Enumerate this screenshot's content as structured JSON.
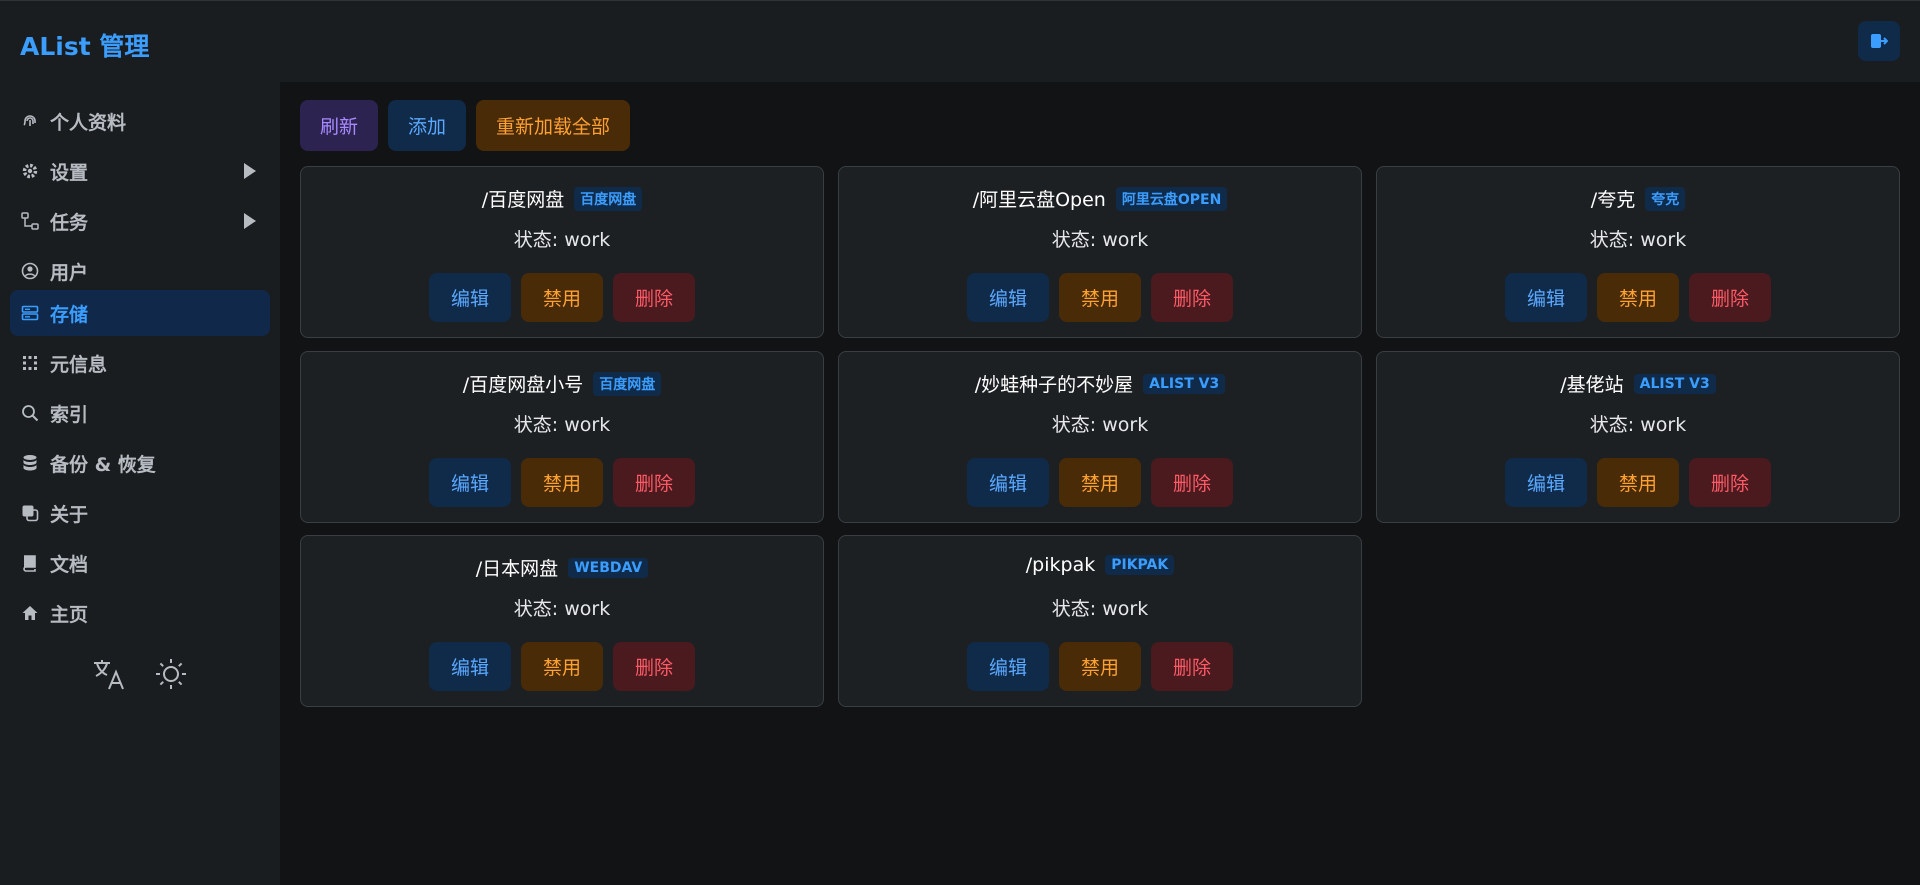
{
  "app": {
    "title": "AList 管理"
  },
  "sidebar": {
    "items": [
      {
        "label": "个人资料",
        "icon": "fingerprint-icon"
      },
      {
        "label": "设置",
        "icon": "gear-icon"
      },
      {
        "label": "任务",
        "icon": "task-flow-icon"
      },
      {
        "label": "用户",
        "icon": "user-circle-icon"
      },
      {
        "label": "存储",
        "icon": "storage-icon"
      },
      {
        "label": "元信息",
        "icon": "meta-grid-icon"
      },
      {
        "label": "索引",
        "icon": "search-icon"
      },
      {
        "label": "备份 & 恢复",
        "icon": "database-icon"
      },
      {
        "label": "关于",
        "icon": "copy-icon"
      },
      {
        "label": "文档",
        "icon": "book-icon"
      },
      {
        "label": "主页",
        "icon": "home-icon"
      }
    ],
    "active": "存储"
  },
  "toolbar": {
    "refresh_label": "刷新",
    "add_label": "添加",
    "reload_label": "重新加载全部"
  },
  "storages": [
    {
      "mount": "/百度网盘",
      "driver": "百度网盘",
      "status_label": "状态:",
      "status": "work"
    },
    {
      "mount": "/阿里云盘Open",
      "driver": "阿里云盘OPEN",
      "status_label": "状态:",
      "status": "work"
    },
    {
      "mount": "/夸克",
      "driver": "夸克",
      "status_label": "状态:",
      "status": "work"
    },
    {
      "mount": "/百度网盘小号",
      "driver": "百度网盘",
      "status_label": "状态:",
      "status": "work"
    },
    {
      "mount": "/妙蛙种子的不妙屋",
      "driver": "ALIST V3",
      "status_label": "状态:",
      "status": "work"
    },
    {
      "mount": "/基佬站",
      "driver": "ALIST V3",
      "status_label": "状态:",
      "status": "work"
    },
    {
      "mount": "/日本网盘",
      "driver": "WEBDAV",
      "status_label": "状态:",
      "status": "work"
    },
    {
      "mount": "/pikpak",
      "driver": "PIKPAK",
      "status_label": "状态:",
      "status": "work"
    }
  ],
  "actions": {
    "edit": "编辑",
    "disable": "禁用",
    "delete": "删除"
  },
  "colors": {
    "accent": "#3b9eff",
    "warning": "#ffa133",
    "danger": "#ff5a66",
    "purple": "#a889ff"
  }
}
